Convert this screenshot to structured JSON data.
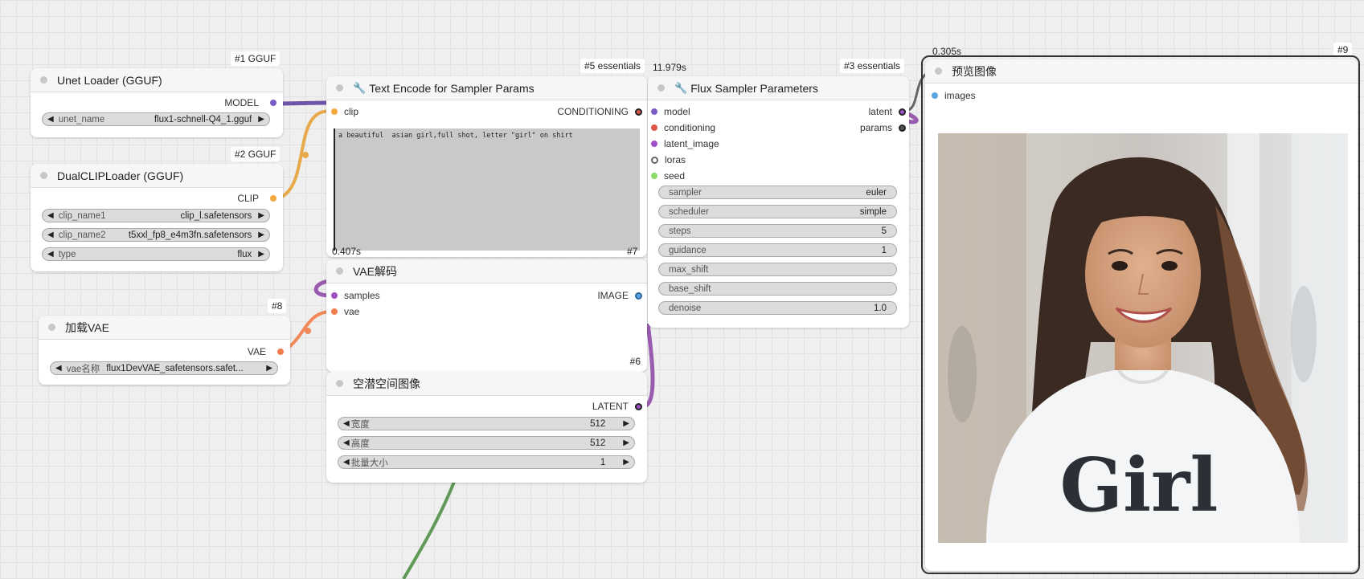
{
  "nodes": {
    "unet_loader": {
      "badge": "#1 GGUF",
      "title": "Unet Loader (GGUF)",
      "output": "MODEL",
      "widgets": [
        {
          "label": "unet_name",
          "value": "flux1-schnell-Q4_1.gguf"
        }
      ]
    },
    "dual_clip": {
      "badge": "#2 GGUF",
      "title": "DualCLIPLoader (GGUF)",
      "output": "CLIP",
      "widgets": [
        {
          "label": "clip_name1",
          "value": "clip_l.safetensors"
        },
        {
          "label": "clip_name2",
          "value": "t5xxl_fp8_e4m3fn.safetensors"
        },
        {
          "label": "type",
          "value": "flux"
        }
      ]
    },
    "load_vae": {
      "badge": "#8",
      "title": "加载VAE",
      "output": "VAE",
      "widgets": [
        {
          "label": "vae名称",
          "value": "flux1DevVAE_safetensors.safet..."
        }
      ]
    },
    "text_encode": {
      "badge": "#5 essentials",
      "title": "Text Encode for Sampler Params",
      "input": "clip",
      "output": "CONDITIONING",
      "prompt": "a beautiful  asian girl,full shot, letter \"girl\" on shirt",
      "timing": "0.407s",
      "corner": "#7"
    },
    "vae_decode": {
      "title": "VAE解码",
      "inputs": [
        "samples",
        "vae"
      ],
      "output": "IMAGE",
      "badge": "#6"
    },
    "latent": {
      "title": "空潜空间图像",
      "output": "LATENT",
      "widgets": [
        {
          "label": "宽度",
          "value": "512"
        },
        {
          "label": "高度",
          "value": "512"
        },
        {
          "label": "批量大小",
          "value": "1"
        }
      ]
    },
    "flux_sampler": {
      "timing": "11.979s",
      "badge": "#3 essentials",
      "title": "Flux Sampler Parameters",
      "inputs": [
        "model",
        "conditioning",
        "latent_image",
        "loras",
        "seed"
      ],
      "outputs": [
        "latent",
        "params"
      ],
      "widgets": [
        {
          "label": "sampler",
          "value": "euler"
        },
        {
          "label": "scheduler",
          "value": "simple"
        },
        {
          "label": "steps",
          "value": "5"
        },
        {
          "label": "guidance",
          "value": "1"
        },
        {
          "label": "max_shift",
          "value": ""
        },
        {
          "label": "base_shift",
          "value": ""
        },
        {
          "label": "denoise",
          "value": "1.0"
        }
      ]
    },
    "preview": {
      "timing": "0.305s",
      "badge": "#9",
      "title": "预览图像",
      "input": "images",
      "shirt_text": "Girl"
    }
  },
  "colors": {
    "model": "#7b5cc4",
    "clip": "#f2a93b",
    "vae": "#f07c4a",
    "conditioning": "#e0574a",
    "latent": "#a050c8",
    "image": "#5aa5e0",
    "seed": "#8cdb6a",
    "params": "#444444",
    "link_model": "#6e55a8",
    "link_clip": "#e8a94a",
    "link_vae": "#f0885a",
    "link_latent": "#9a5cb0",
    "link_seed": "#5e9a56"
  },
  "icons": {
    "arrow_left": "◀",
    "arrow_right": "▶",
    "wrench": "🔧"
  }
}
